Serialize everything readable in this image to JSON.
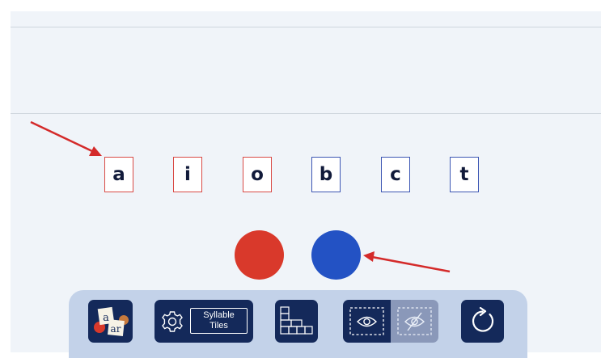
{
  "tiles": [
    {
      "letter": "a",
      "kind": "vowel"
    },
    {
      "letter": "i",
      "kind": "vowel"
    },
    {
      "letter": "o",
      "kind": "vowel"
    },
    {
      "letter": "b",
      "kind": "consonant"
    },
    {
      "letter": "c",
      "kind": "consonant"
    },
    {
      "letter": "t",
      "kind": "consonant"
    }
  ],
  "markers": [
    {
      "color": "#d9392b"
    },
    {
      "color": "#2352c4"
    }
  ],
  "toolbar": {
    "syllable_tiles_label": "Syllable\nTiles",
    "letter_card_top": "a",
    "letter_card_bottom": "ar",
    "icons": [
      "letter-cards-icon",
      "gear-icon",
      "tile-stack-icon",
      "eye-icon",
      "eye-off-icon",
      "reset-icon"
    ]
  },
  "colors": {
    "vowel_border": "#d94a45",
    "consonant_border": "#3c56b3",
    "toolbar_bg": "#c3d2e9",
    "button_bg": "#14295a",
    "annotation_arrow": "#d42a2a"
  }
}
